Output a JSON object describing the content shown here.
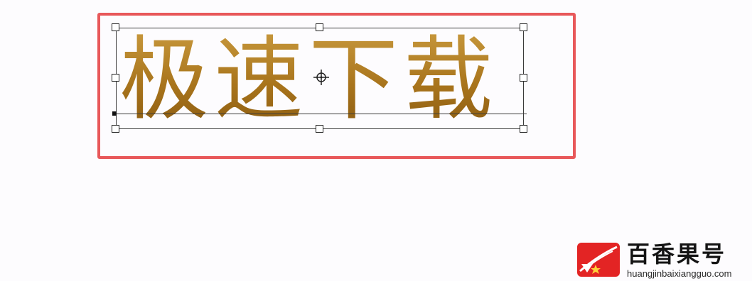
{
  "canvas": {
    "frame_text": "极速下载"
  },
  "annotation": {
    "highlight_color": "#e8585a"
  },
  "watermark": {
    "title": "百香果号",
    "url": "huangjinbaixiangguo.com",
    "logo_icon": "brand-logo-icon",
    "logo_color": "#e32424"
  },
  "colors": {
    "text_gold": "#a8741c",
    "background": "#fdfcfe"
  }
}
